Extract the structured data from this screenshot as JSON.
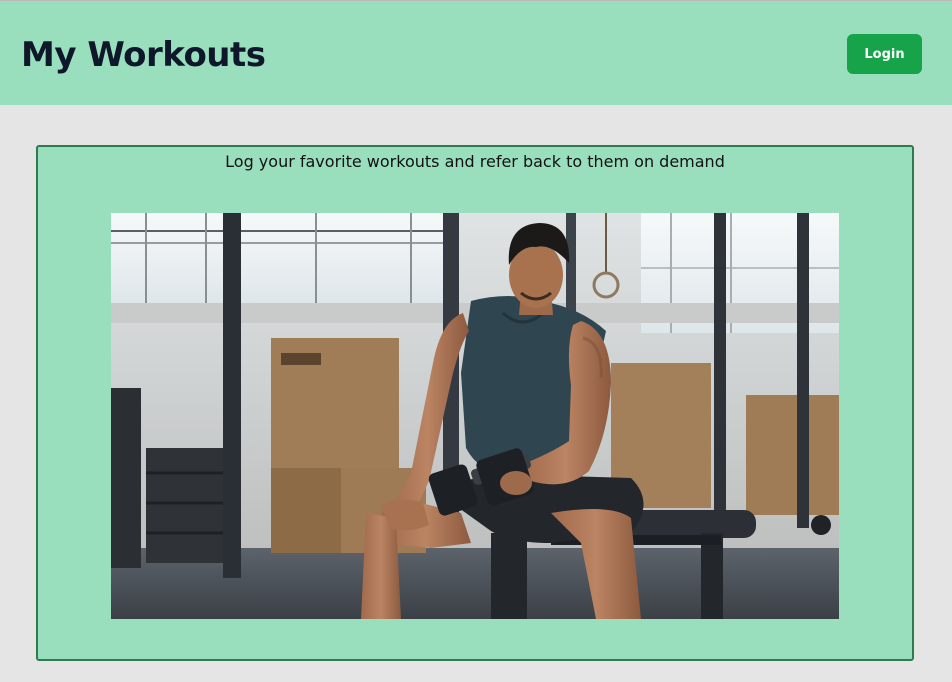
{
  "header": {
    "title": "My Workouts",
    "login_label": "Login"
  },
  "main": {
    "tagline": "Log your favorite workouts and refer back to them on demand",
    "hero_image": {
      "subject": "man seated on a gym bench doing a dumbbell curl"
    }
  },
  "colors": {
    "page_bg": "#e5e5e5",
    "header_bg": "#9adfbd",
    "card_bg": "#9adfbd",
    "card_border": "#2f7a4f",
    "button_bg": "#16a34a",
    "title_text": "#0f172a"
  }
}
